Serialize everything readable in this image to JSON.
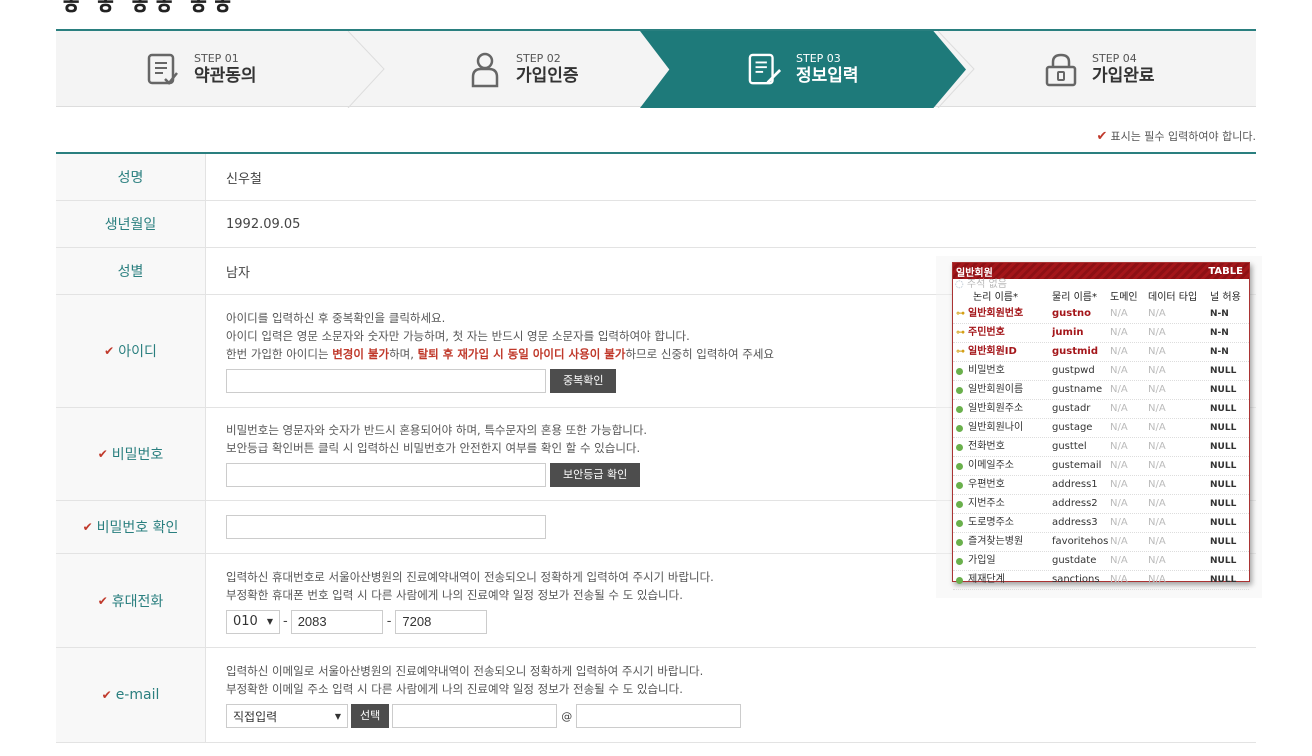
{
  "steps": [
    {
      "num": "STEP 01",
      "name": "약관동의"
    },
    {
      "num": "STEP 02",
      "name": "가입인증"
    },
    {
      "num": "STEP 03",
      "name": "정보입력"
    },
    {
      "num": "STEP 04",
      "name": "가입완료"
    }
  ],
  "required_note": "표시는 필수 입력하여야 합니다.",
  "form": {
    "name_label": "성명",
    "name_value": "신우철",
    "birth_label": "생년월일",
    "birth_value": "1992.09.05",
    "gender_label": "성별",
    "gender_value": "남자",
    "id_label": "아이디",
    "id_desc1": "아이디를 입력하신 후 중복확인을 클릭하세요.",
    "id_desc2": "아이디 입력은 영문 소문자와 숫자만 가능하며, 첫 자는 반드시 영문 소문자를 입력하여야 합니다.",
    "id_desc3a": "한번 가입한 아이디는 ",
    "id_desc3b": "변경이 불가",
    "id_desc3c": "하며, ",
    "id_desc3d": "탈퇴 후 재가입 시 동일 아이디 사용이 불가",
    "id_desc3e": "하므로 신중히 입력하여 주세요",
    "id_check_btn": "중복확인",
    "pw_label": "비밀번호",
    "pw_desc1": "비밀번호는 영문자와 숫자가 반드시 혼용되어야 하며, 특수문자의 혼용 또한 가능합니다.",
    "pw_desc2": "보안등급 확인버튼 클릭 시 입력하신 비밀번호가 안전한지 여부를 확인 할 수 있습니다.",
    "pw_check_btn": "보안등급 확인",
    "pw_confirm_label": "비밀번호 확인",
    "phone_label": "휴대전화",
    "phone_desc1": "입력하신 휴대번호로 서울아산병원의 진료예약내역이 전송되오니 정확하게 입력하여 주시기 바랍니다.",
    "phone_desc2": "부정확한 휴대폰 번호 입력 시 다른 사람에게 나의 진료예약 일정 정보가 전송될 수 도 있습니다.",
    "phone1": "010",
    "phone2": "2083",
    "phone3": "7208",
    "dash": "-",
    "email_label": "e-mail",
    "email_desc1": "입력하신 이메일로 서울아산병원의 진료예약내역이 전송되오니 정확하게 입력하여 주시기 바랍니다.",
    "email_desc2": "부정확한 이메일 주소 입력 시 다른 사람에게 나의 진료예약 일정 정보가 전송될 수 도 있습니다.",
    "email_domain_select": "직접입력",
    "email_select_btn": "선택",
    "at": "@"
  },
  "erd": {
    "title": "일반회원",
    "type": "TABLE",
    "comment": "주석 없음",
    "headers": [
      "논리 이름*",
      "물리 이름*",
      "도메인",
      "데이터 타입",
      "널 허용"
    ],
    "rows": [
      {
        "logical": "일반회원번호",
        "physical": "gustno",
        "domain": "N/A",
        "dtype": "N/A",
        "nullable": "N-N",
        "key": true
      },
      {
        "logical": "주민번호",
        "physical": "jumin",
        "domain": "N/A",
        "dtype": "N/A",
        "nullable": "N-N",
        "key": true
      },
      {
        "logical": "일반회원ID",
        "physical": "gustmid",
        "domain": "N/A",
        "dtype": "N/A",
        "nullable": "N-N",
        "key": true
      },
      {
        "logical": "비밀번호",
        "physical": "gustpwd",
        "domain": "N/A",
        "dtype": "N/A",
        "nullable": "NULL",
        "key": false
      },
      {
        "logical": "일반회원이름",
        "physical": "gustname",
        "domain": "N/A",
        "dtype": "N/A",
        "nullable": "NULL",
        "key": false
      },
      {
        "logical": "일반회원주소",
        "physical": "gustadr",
        "domain": "N/A",
        "dtype": "N/A",
        "nullable": "NULL",
        "key": false
      },
      {
        "logical": "일반회원나이",
        "physical": "gustage",
        "domain": "N/A",
        "dtype": "N/A",
        "nullable": "NULL",
        "key": false
      },
      {
        "logical": "전화번호",
        "physical": "gusttel",
        "domain": "N/A",
        "dtype": "N/A",
        "nullable": "NULL",
        "key": false
      },
      {
        "logical": "이메일주소",
        "physical": "gustemail",
        "domain": "N/A",
        "dtype": "N/A",
        "nullable": "NULL",
        "key": false
      },
      {
        "logical": "우편번호",
        "physical": "address1",
        "domain": "N/A",
        "dtype": "N/A",
        "nullable": "NULL",
        "key": false
      },
      {
        "logical": "지번주소",
        "physical": "address2",
        "domain": "N/A",
        "dtype": "N/A",
        "nullable": "NULL",
        "key": false
      },
      {
        "logical": "도로명주소",
        "physical": "address3",
        "domain": "N/A",
        "dtype": "N/A",
        "nullable": "NULL",
        "key": false
      },
      {
        "logical": "즐겨찾는병원",
        "physical": "favoritehos",
        "domain": "N/A",
        "dtype": "N/A",
        "nullable": "NULL",
        "key": false
      },
      {
        "logical": "가입일",
        "physical": "gustdate",
        "domain": "N/A",
        "dtype": "N/A",
        "nullable": "NULL",
        "key": false
      },
      {
        "logical": "제재단계",
        "physical": "sanctions",
        "domain": "N/A",
        "dtype": "N/A",
        "nullable": "NULL",
        "key": false
      }
    ]
  },
  "colors": {
    "accent": "#1e7a7a",
    "warn": "#c0392b",
    "erd_header": "#a4161a"
  }
}
